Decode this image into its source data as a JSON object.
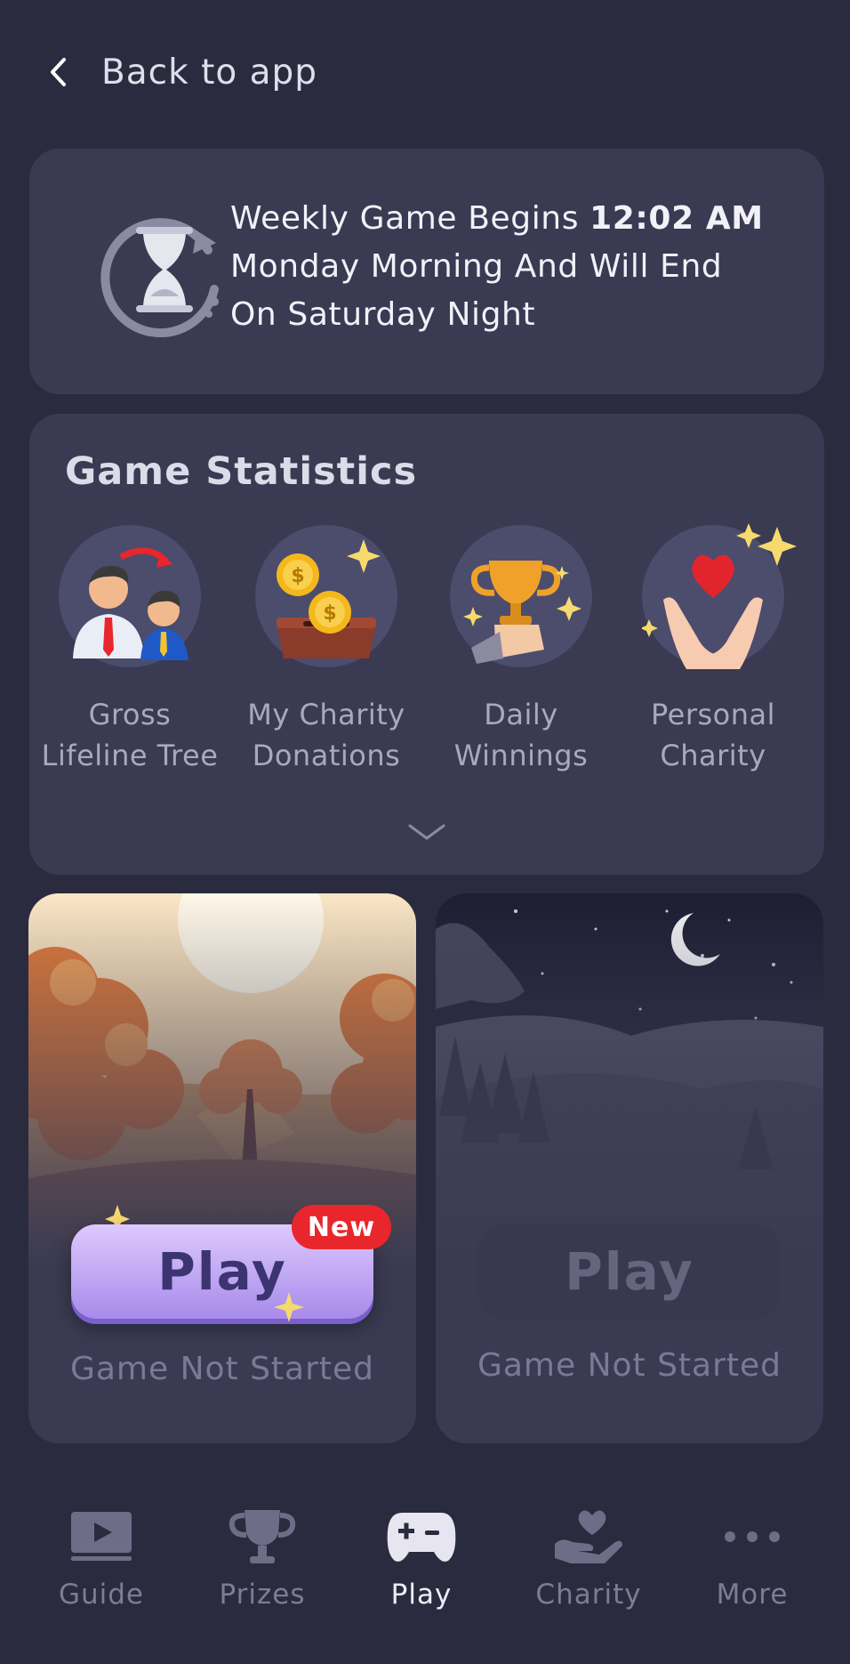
{
  "header": {
    "back_label": "Back to app"
  },
  "weekly": {
    "line1_prefix": "Weekly Game Begins",
    "time": "12:02 AM",
    "line2": "Monday Morning And Will End",
    "line3": "On Saturday Night"
  },
  "stats": {
    "title": "Game Statistics",
    "items": [
      {
        "line1": "Gross",
        "line2": "Lifeline Tree"
      },
      {
        "line1": "My Charity",
        "line2": "Donations"
      },
      {
        "line1": "Daily",
        "line2": "Winnings"
      },
      {
        "line1": "Personal",
        "line2": "Charity"
      }
    ]
  },
  "games": [
    {
      "play_label": "Play",
      "badge": "New",
      "status": "Game Not Started",
      "scene": "autumn-sunset"
    },
    {
      "play_label": "Play",
      "status": "Game Not Started",
      "scene": "night"
    }
  ],
  "tabs": [
    {
      "label": "Guide",
      "icon": "video-icon"
    },
    {
      "label": "Prizes",
      "icon": "trophy-icon"
    },
    {
      "label": "Play",
      "icon": "gamepad-icon",
      "active": true
    },
    {
      "label": "Charity",
      "icon": "charity-hand-icon"
    },
    {
      "label": "More",
      "icon": "more-dots-icon"
    }
  ],
  "colors": {
    "background": "#2b2b3f",
    "card": "#3a3a52",
    "play_button": "#b9a2f2",
    "new_badge": "#e8262c"
  }
}
